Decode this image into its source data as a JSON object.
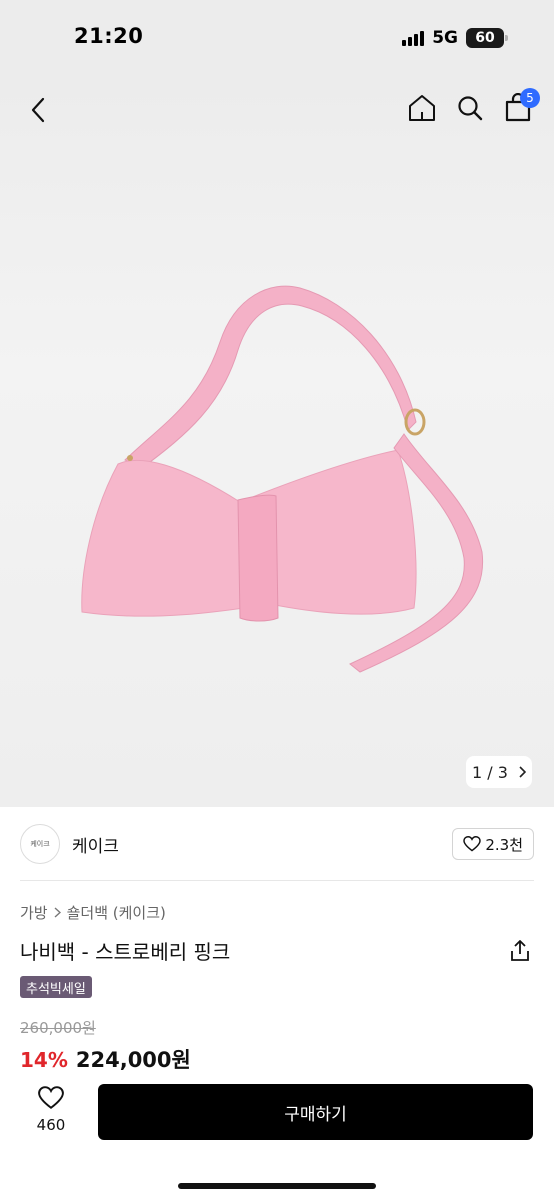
{
  "status_bar": {
    "time": "21:20",
    "network": "5G",
    "battery": "60"
  },
  "header": {
    "cart_count": "5"
  },
  "gallery": {
    "current": "1",
    "total": "3",
    "separator": "/"
  },
  "seller": {
    "logo_text": "케이크",
    "name": "케이크",
    "followers": "2.3천"
  },
  "breadcrumb": {
    "category": "가방",
    "subcategory": "숄더백 (케이크)"
  },
  "product": {
    "title": "나비백 - 스트로베리 핑크",
    "sale_badge": "추석빅세일",
    "original_price": "260,000원",
    "discount": "14%",
    "price": "224,000원"
  },
  "actions": {
    "like_count": "460",
    "buy_label": "구매하기"
  },
  "colors": {
    "accent_red": "#e0262b",
    "badge_purple": "#6a5a74",
    "buy_black": "#000000",
    "cart_badge_blue": "#2f6bff",
    "bag_pink": "#f4b1c7"
  },
  "icons": [
    "back-icon",
    "home-icon",
    "search-icon",
    "shopping-bag-icon",
    "chevron-right-icon",
    "heart-icon",
    "share-icon"
  ]
}
